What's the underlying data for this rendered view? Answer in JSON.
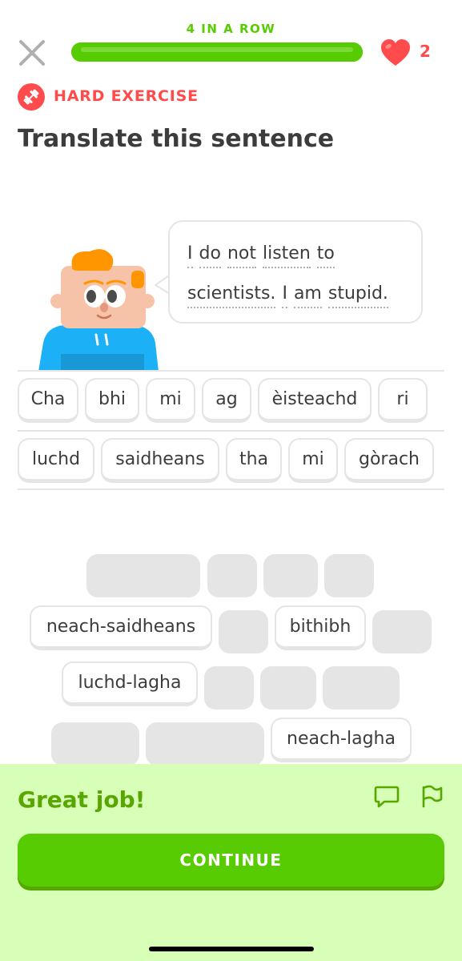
{
  "header": {
    "streak_label": "4 IN A ROW",
    "progress_fraction": 1.0,
    "hearts_count": "2",
    "badge_label": "HARD EXERCISE",
    "title": "Translate this sentence"
  },
  "prompt": {
    "line1": [
      "I",
      "do",
      "not",
      "listen",
      "to"
    ],
    "line2": [
      "scientists.",
      "I",
      "am",
      "stupid."
    ]
  },
  "answer": {
    "row1": [
      "Cha",
      "bhi",
      "mi",
      "ag",
      "èisteachd",
      "ri"
    ],
    "row2": [
      "luchd",
      "saidheans",
      "tha",
      "mi",
      "gòrach"
    ]
  },
  "word_bank": {
    "remaining": [
      "neach-saidheans",
      "bithibh",
      "luchd-lagha",
      "neach-lagha"
    ]
  },
  "feedback": {
    "message": "Great job!",
    "continue_label": "CONTINUE"
  },
  "colors": {
    "primary_green": "#58cc02",
    "dark_green": "#58a700",
    "feedback_bg": "#d7ffb8",
    "heart_red": "#ff4b4b",
    "chip_border": "#e5e5e5"
  },
  "icons": {
    "close": "close-icon",
    "heart": "heart-icon",
    "hard_badge": "dumbbell-icon",
    "discuss": "comment-icon",
    "report": "flag-icon"
  }
}
